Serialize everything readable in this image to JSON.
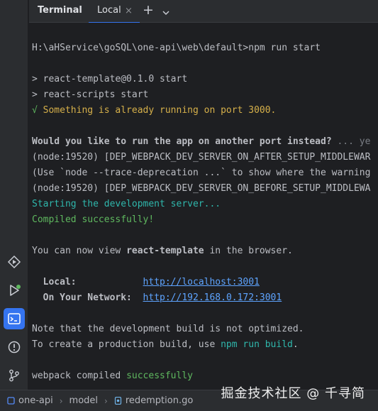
{
  "toolstrip": {
    "items": [
      {
        "icon": "services-icon"
      },
      {
        "icon": "run-icon"
      },
      {
        "icon": "terminal-icon",
        "active": true
      },
      {
        "icon": "problems-icon"
      },
      {
        "icon": "git-icon"
      }
    ]
  },
  "tabbar": {
    "title": "Terminal",
    "tab_label": "Local",
    "close_glyph": "×",
    "add_glyph": "+"
  },
  "terminal": {
    "prompt": "H:\\aHService\\goSQL\\one-api\\web\\default>npm run start",
    "pkg_line": "> react-template@0.1.0 start",
    "scripts_line": "> react-scripts start",
    "port_check": "√",
    "port_msg": " Something is already running on port 3000.",
    "question": "Would you like to run the app on another port instead?",
    "question_tail": " ... ye",
    "dep_after": "(node:19520) [DEP_WEBPACK_DEV_SERVER_ON_AFTER_SETUP_MIDDLEWAR",
    "trace_a": "(Use `node --trace-deprecation ...` to show where the warning",
    "dep_before": "(node:19520) [DEP_WEBPACK_DEV_SERVER_ON_BEFORE_SETUP_MIDDLEWA",
    "starting": "Starting the development server...",
    "compiled": "Compiled successfully!",
    "view_a": "You can now view ",
    "view_app": "react-template",
    "view_b": " in the browser.",
    "local_label": "  Local:            ",
    "local_url": "http://localhost:3001",
    "network_label": "  On Your Network:  ",
    "network_url": "http://192.168.0.172:3001",
    "note": "Note that the development build is not optimized.",
    "prod_a": "To create a production build, use ",
    "prod_cmd": "npm run build",
    "prod_b": ".",
    "webpack_a": "webpack compiled ",
    "webpack_b": "successfully"
  },
  "breadcrumb": {
    "items": [
      "one-api",
      "model",
      "redemption.go"
    ]
  },
  "watermark": "掘金技术社区 @ 千寻简",
  "colors": {
    "accent": "#3574f0",
    "green": "#5fb85f",
    "yellow": "#d6b04a",
    "cyan": "#2fb7ac",
    "link": "#5ea4ff"
  }
}
